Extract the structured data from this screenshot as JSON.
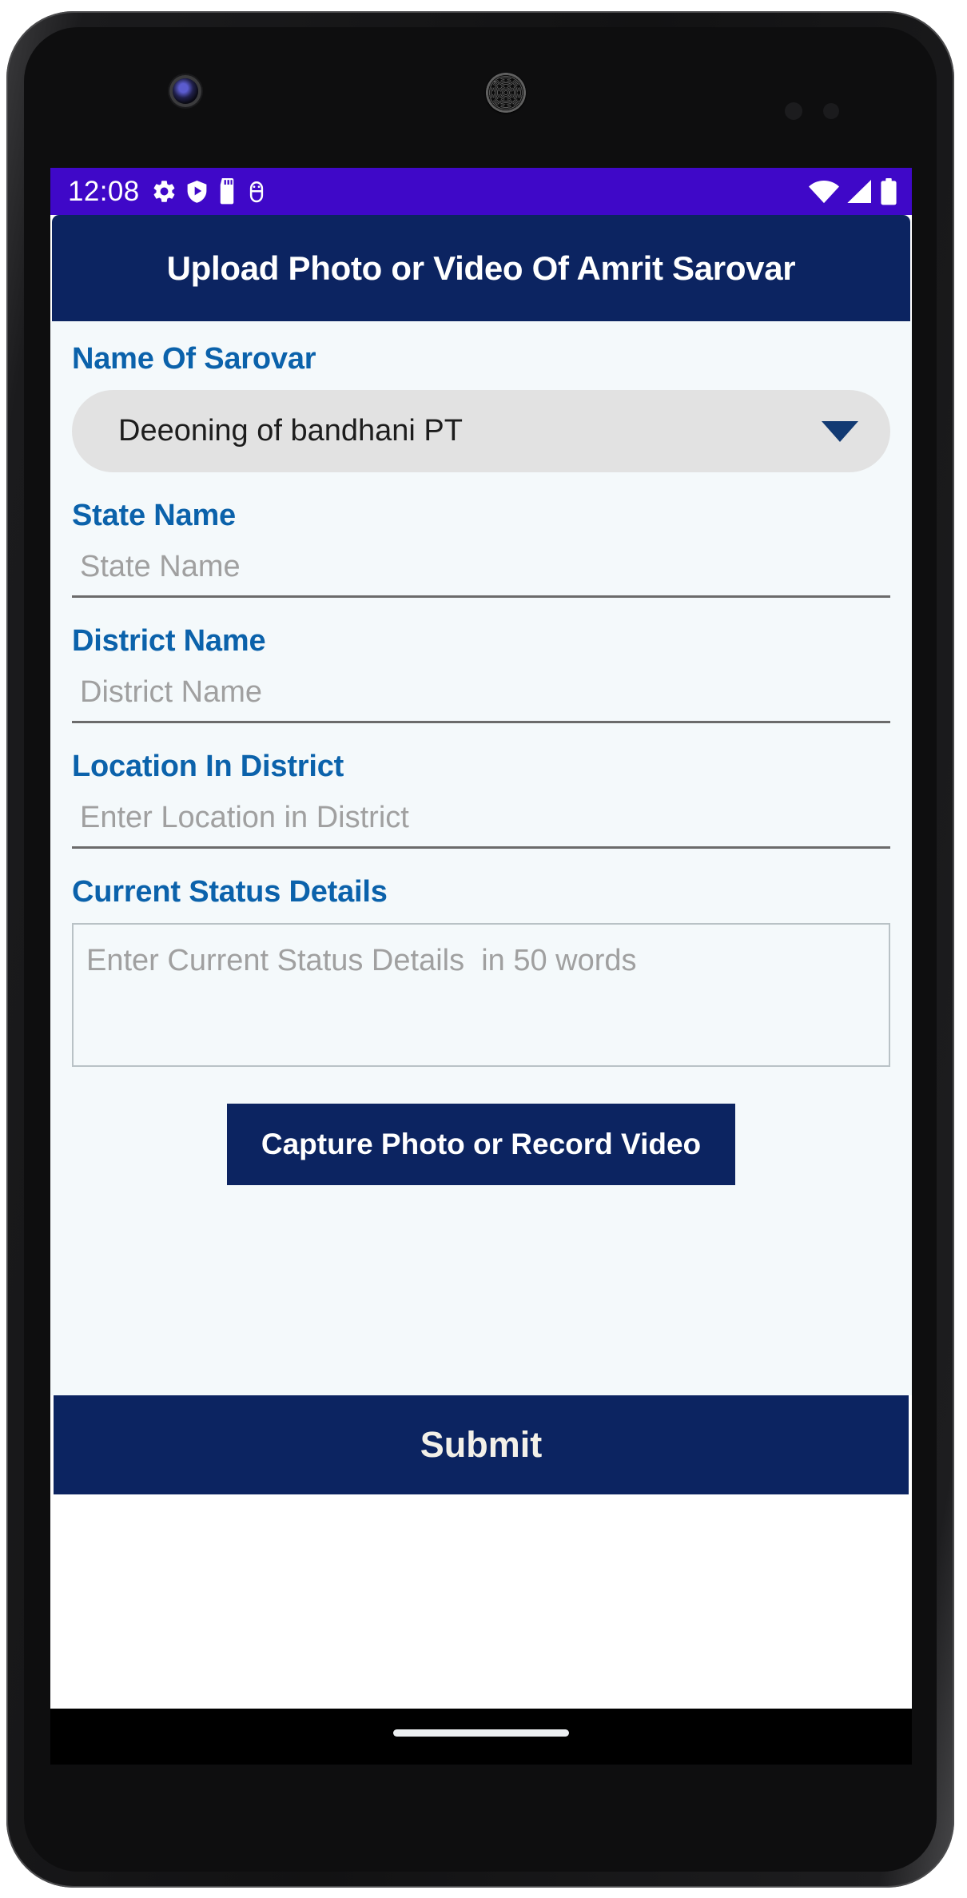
{
  "status_bar": {
    "time": "12:08",
    "left_icons": [
      "gear-icon",
      "play-shield-icon",
      "sd-card-icon",
      "android-debug-icon"
    ],
    "right_icons": [
      "wifi-icon",
      "cellular-signal-icon",
      "battery-icon"
    ],
    "background_color": "#3f08c8"
  },
  "app_bar": {
    "title": "Upload Photo or Video Of Amrit Sarovar",
    "background_color": "#0c2461",
    "text_color": "#ffffff"
  },
  "form": {
    "label_color": "#0b62ab",
    "background_color": "#f4f9fb",
    "sarovar": {
      "label": "Name Of Sarovar",
      "selected_value": "Deeoning of bandhani PT",
      "caret_icon": "chevron-down-icon"
    },
    "state": {
      "label": "State Name",
      "value": "",
      "placeholder": "State Name"
    },
    "district": {
      "label": "District Name",
      "value": "",
      "placeholder": "District Name"
    },
    "location": {
      "label": "Location In District",
      "value": "",
      "placeholder": "Enter Location in District"
    },
    "status_details": {
      "label": "Current Status Details",
      "value": "",
      "placeholder": "Enter Current Status Details  in 50 words"
    }
  },
  "actions": {
    "capture_label": "Capture Photo or Record Video",
    "submit_label": "Submit",
    "button_color": "#0c2461"
  }
}
